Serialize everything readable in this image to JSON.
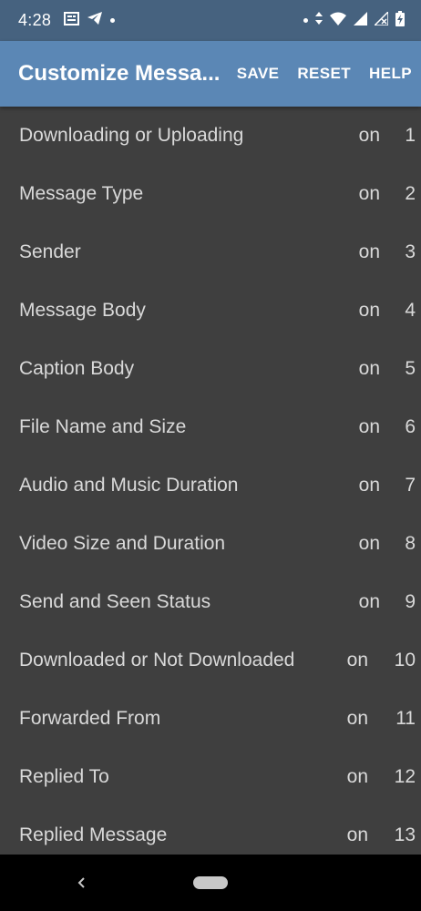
{
  "status_bar": {
    "time": "4:28",
    "left_icons": [
      "news-icon",
      "telegram-icon",
      "dot-icon"
    ],
    "right_icons": [
      "dot-icon",
      "data-arrows-icon",
      "wifi-icon",
      "signal-icon",
      "signal-no-data-icon",
      "battery-charging-icon"
    ]
  },
  "app_bar": {
    "title": "Customize Messa...",
    "actions": {
      "save": "SAVE",
      "reset": "RESET",
      "help": "HELP"
    },
    "background": "#5b87b5"
  },
  "list": {
    "items": [
      {
        "label": "Downloading or Uploading",
        "state": "on",
        "index": "1"
      },
      {
        "label": "Message Type",
        "state": "on",
        "index": "2"
      },
      {
        "label": "Sender",
        "state": "on",
        "index": "3"
      },
      {
        "label": "Message Body",
        "state": "on",
        "index": "4"
      },
      {
        "label": "Caption Body",
        "state": "on",
        "index": "5"
      },
      {
        "label": "File Name and Size",
        "state": "on",
        "index": "6"
      },
      {
        "label": "Audio and Music Duration",
        "state": "on",
        "index": "7"
      },
      {
        "label": "Video Size and Duration",
        "state": "on",
        "index": "8"
      },
      {
        "label": "Send and Seen Status",
        "state": "on",
        "index": "9"
      },
      {
        "label": "Downloaded or Not Downloaded",
        "state": "on",
        "index": "10"
      },
      {
        "label": "Forwarded From",
        "state": "on",
        "index": "11"
      },
      {
        "label": "Replied To",
        "state": "on",
        "index": "12"
      },
      {
        "label": "Replied Message",
        "state": "on",
        "index": "13"
      }
    ]
  },
  "nav_bar": {
    "icons": [
      "back-icon",
      "home-pill-icon"
    ]
  }
}
